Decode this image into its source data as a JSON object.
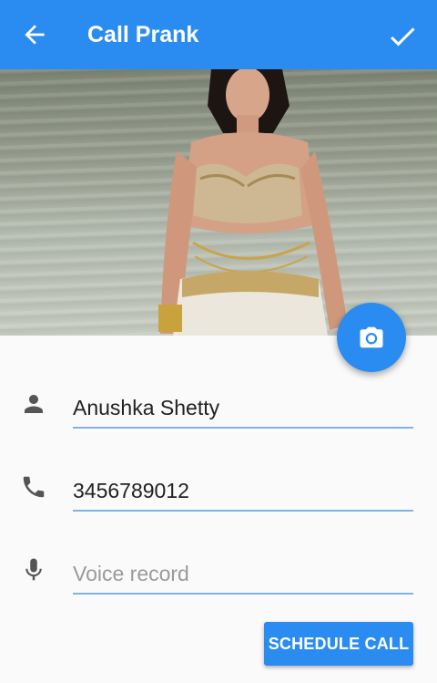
{
  "app": {
    "title": "Call Prank",
    "accent_color": "#2a8cf1"
  },
  "appbar": {
    "back_icon": "arrow-left-icon",
    "confirm_icon": "check-icon"
  },
  "photo": {
    "fab_icon": "camera-icon"
  },
  "form": {
    "name": {
      "icon": "person-icon",
      "value": "Anushka Shetty",
      "placeholder": ""
    },
    "phone": {
      "icon": "phone-icon",
      "value": "3456789012",
      "placeholder": ""
    },
    "voice": {
      "icon": "microphone-icon",
      "value": "",
      "placeholder": "Voice record"
    }
  },
  "actions": {
    "schedule_label": "SCHEDULE CALL"
  }
}
